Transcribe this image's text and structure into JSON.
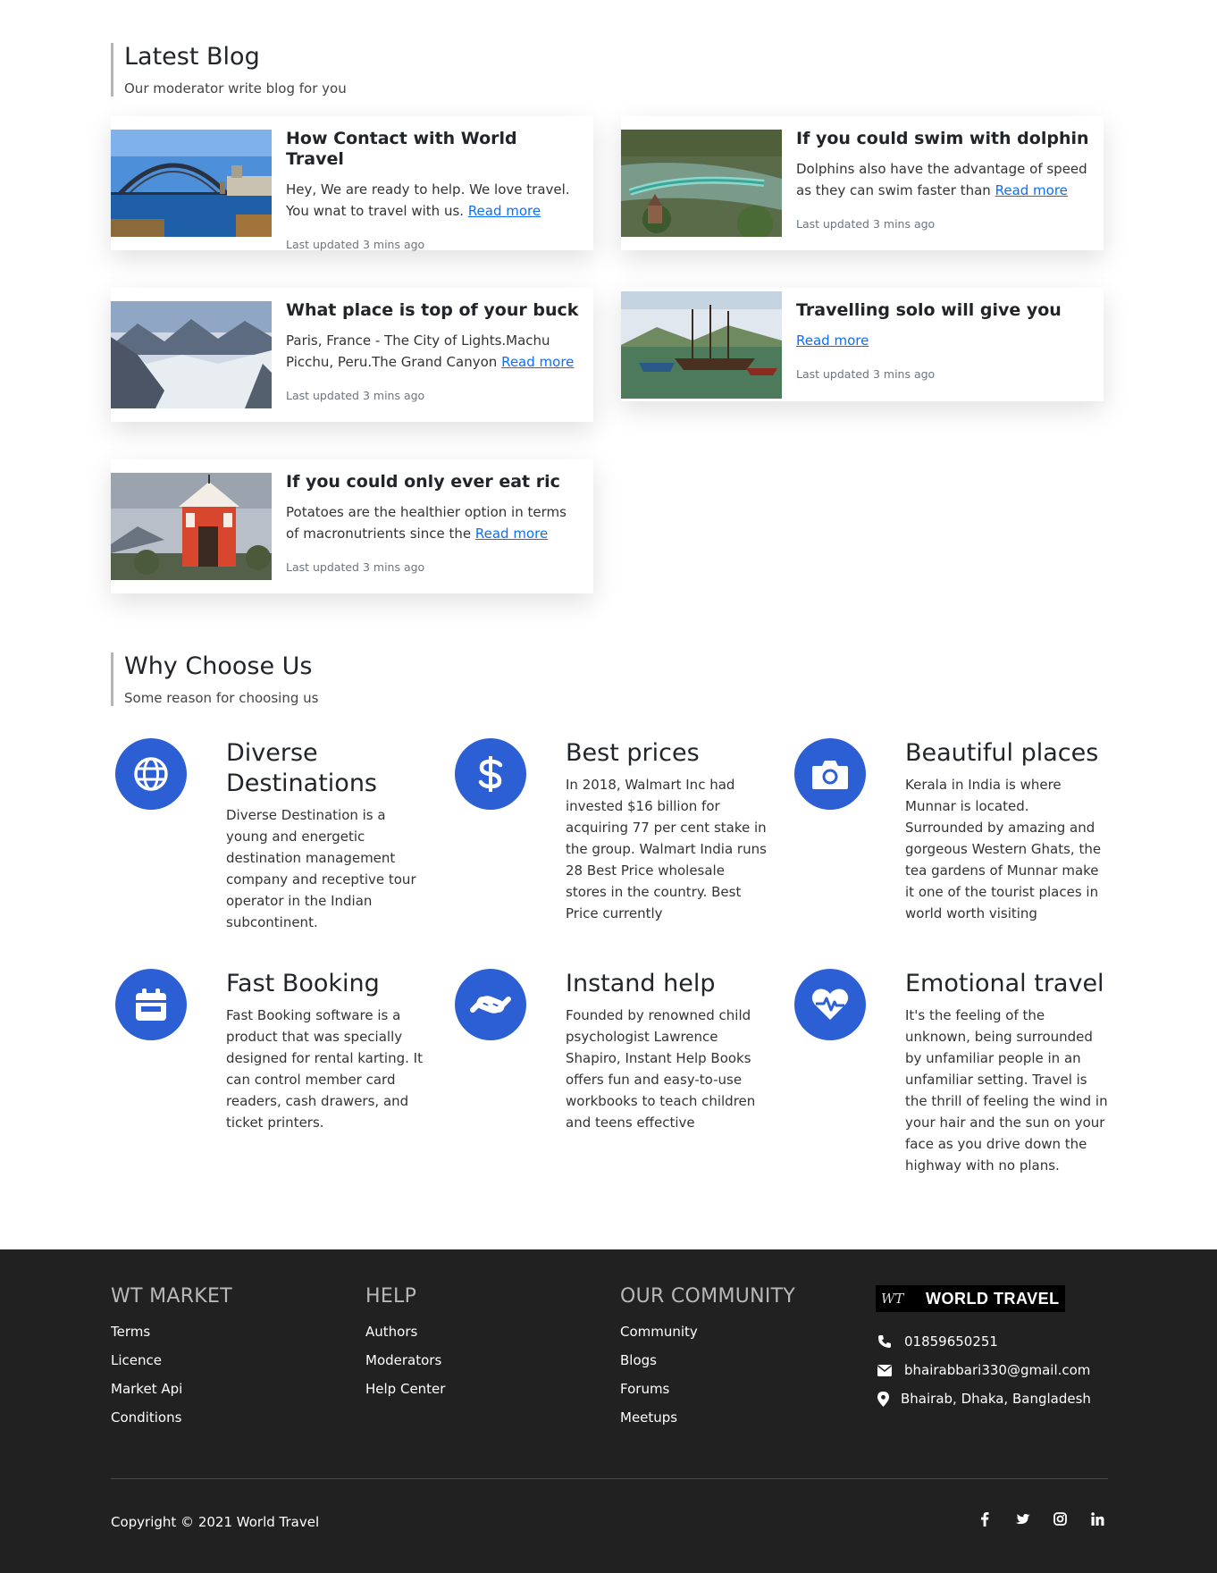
{
  "blog": {
    "title": "Latest Blog",
    "subtitle": "Our moderator write blog for you",
    "posts": [
      {
        "title": "How Contact with World Travel",
        "text": "Hey, We are ready to help. We love travel. You wnat to travel with us.",
        "link": "Read more",
        "meta": "Last updated 3 mins ago"
      },
      {
        "title": "If you could swim with dolphin",
        "text": "Dolphins also have the advantage of speed as they can swim faster than",
        "link": "Read more",
        "meta": "Last updated 3 mins ago"
      },
      {
        "title": "What place is top of your buck",
        "text": "Paris, France - The City of Lights.Machu Picchu, Peru.The Grand Canyon",
        "link": "Read more",
        "meta": "Last updated 3 mins ago"
      },
      {
        "title": "Travelling solo will give you",
        "text": "",
        "link": "Read more",
        "meta": "Last updated 3 mins ago"
      },
      {
        "title": "If you could only ever eat ric",
        "text": "Potatoes are the healthier option in terms of macronutrients since the",
        "link": "Read more",
        "meta": "Last updated 3 mins ago"
      }
    ]
  },
  "why": {
    "title": "Why Choose Us",
    "subtitle": "Some reason for choosing us",
    "features": [
      {
        "icon": "globe-icon",
        "title": "Diverse Destinations",
        "desc": "Diverse Destination is a young and energetic destination management company and receptive tour operator in the Indian subcontinent."
      },
      {
        "icon": "dollar-icon",
        "title": "Best prices",
        "desc": "In 2018, Walmart Inc had invested $16 billion for acquiring 77 per cent stake in the group. Walmart India runs 28 Best Price wholesale stores in the country. Best Price currently"
      },
      {
        "icon": "camera-icon",
        "title": "Beautiful places",
        "desc": "Kerala in India is where Munnar is located. Surrounded by amazing and gorgeous Western Ghats, the tea gardens of Munnar make it one of the tourist places in world worth visiting"
      },
      {
        "icon": "calendar-icon",
        "title": "Fast Booking",
        "desc": "Fast Booking software is a product that was specially designed for rental karting. It can control member card readers, cash drawers, and ticket printers."
      },
      {
        "icon": "handshake-icon",
        "title": "Instand help",
        "desc": "Founded by renowned child psychologist Lawrence Shapiro, Instant Help Books offers fun and easy-to-use workbooks to teach children and teens effective"
      },
      {
        "icon": "heart-pulse-icon",
        "title": "Emotional travel",
        "desc": "It's the feeling of the unknown, being surrounded by unfamiliar people in an unfamiliar setting. Travel is the thrill of feeling the wind in your hair and the sun on your face as you drive down the highway with no plans."
      }
    ]
  },
  "footer": {
    "col1": {
      "title": "WT MARKET",
      "links": [
        "Terms",
        "Licence",
        "Market Api",
        "Conditions"
      ]
    },
    "col2": {
      "title": "HELP",
      "links": [
        "Authors",
        "Moderators",
        "Help Center"
      ]
    },
    "col3": {
      "title": "OUR COMMUNITY",
      "links": [
        "Community",
        "Blogs",
        "Forums",
        "Meetups"
      ]
    },
    "logo": {
      "mark": "WT",
      "text": "WORLD TRAVEL"
    },
    "phone": "01859650251",
    "email": "bhairabbari330@gmail.com",
    "address": "Bhairab, Dhaka, Bangladesh",
    "copyright": "Copyright © 2021 World Travel",
    "socials": [
      "facebook-icon",
      "twitter-icon",
      "instagram-icon",
      "linkedin-icon"
    ]
  },
  "colors": {
    "accent": "#2c5fd4",
    "footer_bg": "#212121",
    "link": "#0d6efd"
  }
}
